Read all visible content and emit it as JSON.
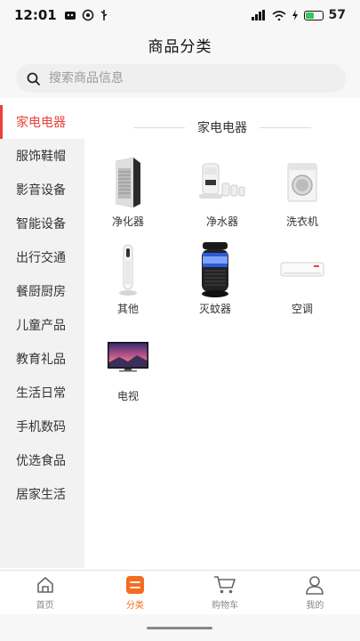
{
  "status": {
    "time": "12:01",
    "battery": "57",
    "battery_level": 0.57
  },
  "header": {
    "title": "商品分类"
  },
  "search": {
    "placeholder": "搜索商品信息"
  },
  "sidebar": {
    "items": [
      {
        "label": "家电电器",
        "active": true
      },
      {
        "label": "服饰鞋帽"
      },
      {
        "label": "影音设备"
      },
      {
        "label": "智能设备"
      },
      {
        "label": "出行交通"
      },
      {
        "label": "餐厨厨房"
      },
      {
        "label": "儿童产品"
      },
      {
        "label": "教育礼品"
      },
      {
        "label": "生活日常"
      },
      {
        "label": "手机数码"
      },
      {
        "label": "优选食品"
      },
      {
        "label": "居家生活"
      }
    ]
  },
  "section": {
    "title": "家电电器"
  },
  "products": [
    {
      "label": "净化器",
      "icon": "air-purifier-image"
    },
    {
      "label": "净水器",
      "icon": "water-purifier-image"
    },
    {
      "label": "洗衣机",
      "icon": "washing-machine-image"
    },
    {
      "label": "其他",
      "icon": "tower-fan-image"
    },
    {
      "label": "灭蚊器",
      "icon": "mosquito-killer-image"
    },
    {
      "label": "空调",
      "icon": "air-conditioner-image"
    },
    {
      "label": "电视",
      "icon": "television-image"
    }
  ],
  "tabbar": {
    "items": [
      {
        "label": "首页",
        "icon": "home-icon"
      },
      {
        "label": "分类",
        "icon": "category-icon",
        "active": true
      },
      {
        "label": "购物车",
        "icon": "cart-icon"
      },
      {
        "label": "我的",
        "icon": "profile-icon"
      }
    ]
  },
  "colors": {
    "accent": "#e8433a",
    "tab_active": "#f36d21",
    "sidebar_bg": "#f2f2f2"
  }
}
